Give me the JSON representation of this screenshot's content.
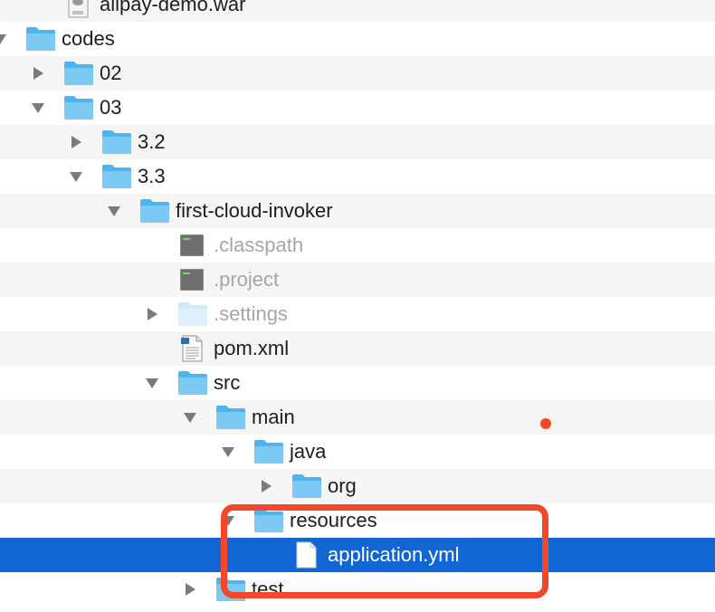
{
  "tree": {
    "items": [
      {
        "label": "alipay-demo.war",
        "kind": "war",
        "level": 1,
        "disclosure": "none"
      },
      {
        "label": "codes",
        "kind": "folder",
        "level": 0,
        "disclosure": "expanded"
      },
      {
        "label": "02",
        "kind": "folder",
        "level": 1,
        "disclosure": "collapsed"
      },
      {
        "label": "03",
        "kind": "folder",
        "level": 1,
        "disclosure": "expanded"
      },
      {
        "label": "3.2",
        "kind": "folder",
        "level": 2,
        "disclosure": "collapsed"
      },
      {
        "label": "3.3",
        "kind": "folder",
        "level": 2,
        "disclosure": "expanded"
      },
      {
        "label": "first-cloud-invoker",
        "kind": "folder",
        "level": 3,
        "disclosure": "expanded"
      },
      {
        "label": ".classpath",
        "kind": "exec",
        "level": 4,
        "disclosure": "none",
        "dim": true
      },
      {
        "label": ".project",
        "kind": "exec",
        "level": 4,
        "disclosure": "none",
        "dim": true
      },
      {
        "label": ".settings",
        "kind": "folder",
        "level": 4,
        "disclosure": "collapsed",
        "dim": true
      },
      {
        "label": "pom.xml",
        "kind": "xml",
        "level": 4,
        "disclosure": "none"
      },
      {
        "label": "src",
        "kind": "folder",
        "level": 4,
        "disclosure": "expanded"
      },
      {
        "label": "main",
        "kind": "folder",
        "level": 5,
        "disclosure": "expanded"
      },
      {
        "label": "java",
        "kind": "folder",
        "level": 6,
        "disclosure": "expanded"
      },
      {
        "label": "org",
        "kind": "folder",
        "level": 7,
        "disclosure": "collapsed"
      },
      {
        "label": "resources",
        "kind": "folder",
        "level": 6,
        "disclosure": "expanded"
      },
      {
        "label": "application.yml",
        "kind": "doc",
        "level": 7,
        "disclosure": "none",
        "selected": true
      },
      {
        "label": "test",
        "kind": "folder",
        "level": 5,
        "disclosure": "collapsed"
      }
    ]
  },
  "colors": {
    "selection": "#1166d3",
    "annotation": "#f2472b",
    "folder": "#5ab8ee",
    "stripe": "#f5f5f5"
  }
}
